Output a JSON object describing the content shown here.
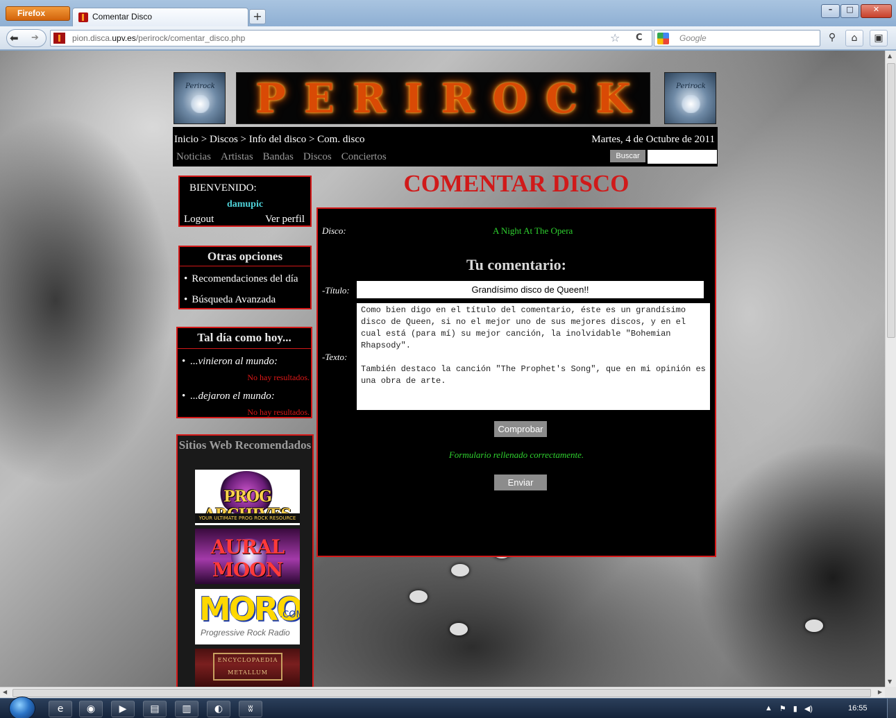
{
  "browser": {
    "app_button": "Firefox",
    "tab_title": "Comentar Disco",
    "new_tab": "+",
    "url_prefix": "pion.disca.",
    "url_domain": "upv.es",
    "url_path": "/perirock/comentar_disco.php",
    "search_placeholder": "Google"
  },
  "site": {
    "logo_text": "Perirock",
    "banner_letters": [
      "P",
      "E",
      "R",
      "I",
      "R",
      "O",
      "C",
      "K"
    ]
  },
  "topbar": {
    "breadcrumb": "Inicio > Discos > Info del disco > Com. disco",
    "date": "Martes, 4 de Octubre de 2011",
    "menu": [
      "Noticias",
      "Artistas",
      "Bandas",
      "Discos",
      "Conciertos"
    ],
    "search_button": "Buscar"
  },
  "sidebar": {
    "welcome_title": "BIENVENIDO:",
    "username": "damupic",
    "logout": "Logout",
    "profile": "Ver perfil",
    "options_title": "Otras opciones",
    "options": [
      "Recomendaciones del día",
      "Búsqueda Avanzada"
    ],
    "onthisday_title": "Tal día como hoy...",
    "born": "...vinieron al mundo:",
    "died": "...dejaron el mundo:",
    "no_results": "No hay resultados.",
    "sites_title": "Sitios Web Recomendados",
    "sites": {
      "prog": "PROG ARCHIVES",
      "prog_sub": "YOUR ULTIMATE PROG ROCK RESOURCE",
      "aural": "AURAL MOON",
      "morow": "MOROW",
      "morow_com": ".COM",
      "morow_sub": "Progressive Rock Radio",
      "metal": "ENCYCLOPAEDIA METALLUM"
    }
  },
  "form": {
    "page_title": "COMENTAR DISCO",
    "disco_label": "Disco:",
    "disco_value": "A Night At The Opera",
    "section_title": "Tu comentario:",
    "titulo_label": "-Título:",
    "titulo_value": "Grandísimo disco de Queen!!",
    "texto_label": "-Texto:",
    "texto_value": "Como bien digo en el título del comentario, éste es un grandísimo disco de Queen, si no el mejor uno de sus mejores discos, y en el cual está (para mí) su mejor canción, la inolvidable \"Bohemian Rhapsody\".\n\nTambién destaco la canción \"The Prophet's Song\", que en mi opinión es una obra de arte.",
    "check_button": "Comprobar",
    "status": "Formulario rellenado correctamente.",
    "send_button": "Enviar"
  },
  "taskbar": {
    "clock": "16:55"
  }
}
